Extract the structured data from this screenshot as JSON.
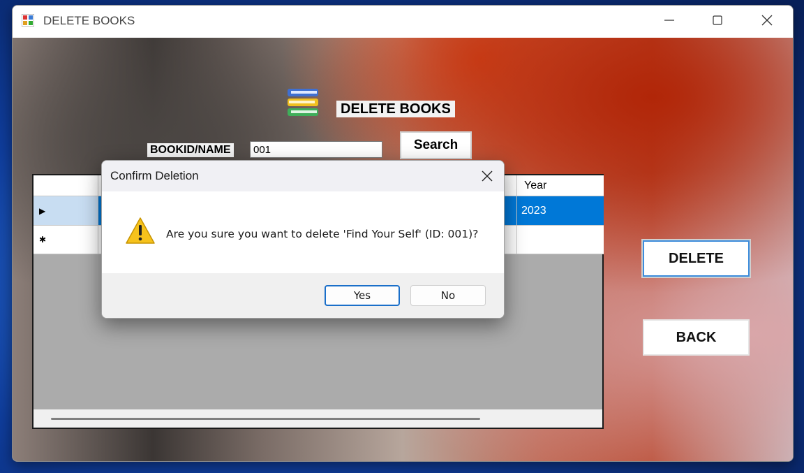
{
  "window": {
    "title": "DELETE BOOKS"
  },
  "form": {
    "heading": "DELETE BOOKS",
    "field_label": "BOOKID/NAME",
    "field_value": "001",
    "search_label": "Search",
    "delete_label": "DELETE",
    "back_label": "BACK"
  },
  "grid": {
    "visible_header": "Year",
    "rows": [
      {
        "marker": "▶",
        "year": "2023",
        "selected": true
      },
      {
        "marker": "✱",
        "year": "",
        "selected": false
      }
    ]
  },
  "dialog": {
    "title": "Confirm Deletion",
    "message": "Are you sure you want to delete 'Find Your Self' (ID: 001)?",
    "yes_label": "Yes",
    "no_label": "No"
  },
  "colors": {
    "selection": "#0078d7",
    "accent_border": "#1a6fc9"
  },
  "icons": [
    "app-icon",
    "minimize-icon",
    "maximize-icon",
    "close-icon",
    "books-icon",
    "warning-icon"
  ]
}
